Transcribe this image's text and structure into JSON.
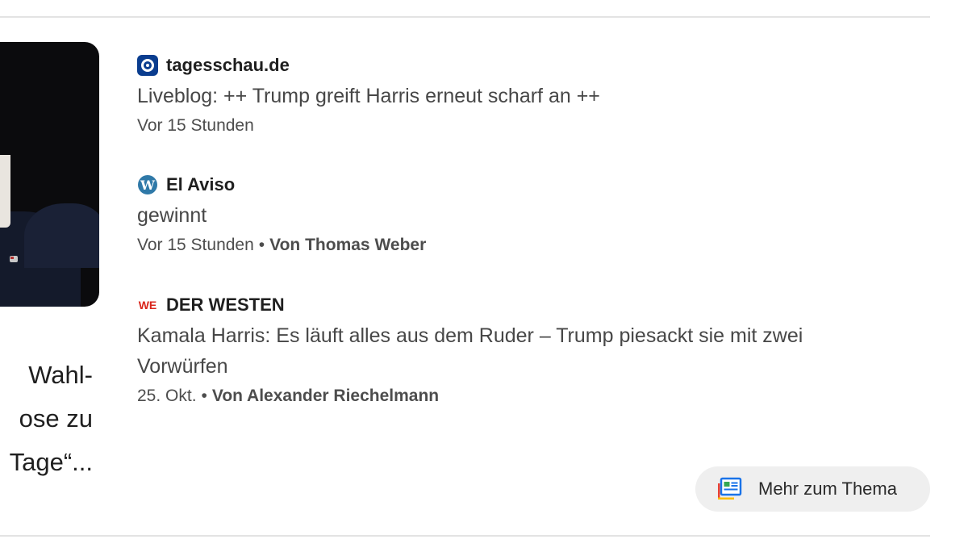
{
  "featured": {
    "title_lines": [
      "Wahl-",
      "ose zu",
      "Tage“..."
    ]
  },
  "articles": [
    {
      "source": "tagesschau.de",
      "favicon": "tagesschau-icon",
      "headline": "Liveblog: ++ Trump greift Harris erneut scharf an ++",
      "time": "Vor 15 Stunden",
      "author": ""
    },
    {
      "source": "El Aviso",
      "favicon": "wordpress-icon",
      "headline": "gewinnt",
      "time": "Vor 15 Stunden",
      "author": "Von Thomas Weber"
    },
    {
      "source": "DER WESTEN",
      "favicon": "der-westen-icon",
      "favicon_text": "WE",
      "headline_lines": [
        "Kamala Harris: Es läuft alles aus dem Ruder – Trump piesackt sie mit zwei",
        "Vorwürfen"
      ],
      "time": "25. Okt.",
      "author": "Von Alexander Riechelmann"
    }
  ],
  "more_button": {
    "label": "Mehr zum Thema",
    "icon": "news-stack-icon"
  },
  "separator": "•",
  "colors": {
    "tagesschau": "#0a3d8f",
    "wordpress": "#2f79a8",
    "der_westen": "#d9261c",
    "button_bg": "#efefef"
  }
}
